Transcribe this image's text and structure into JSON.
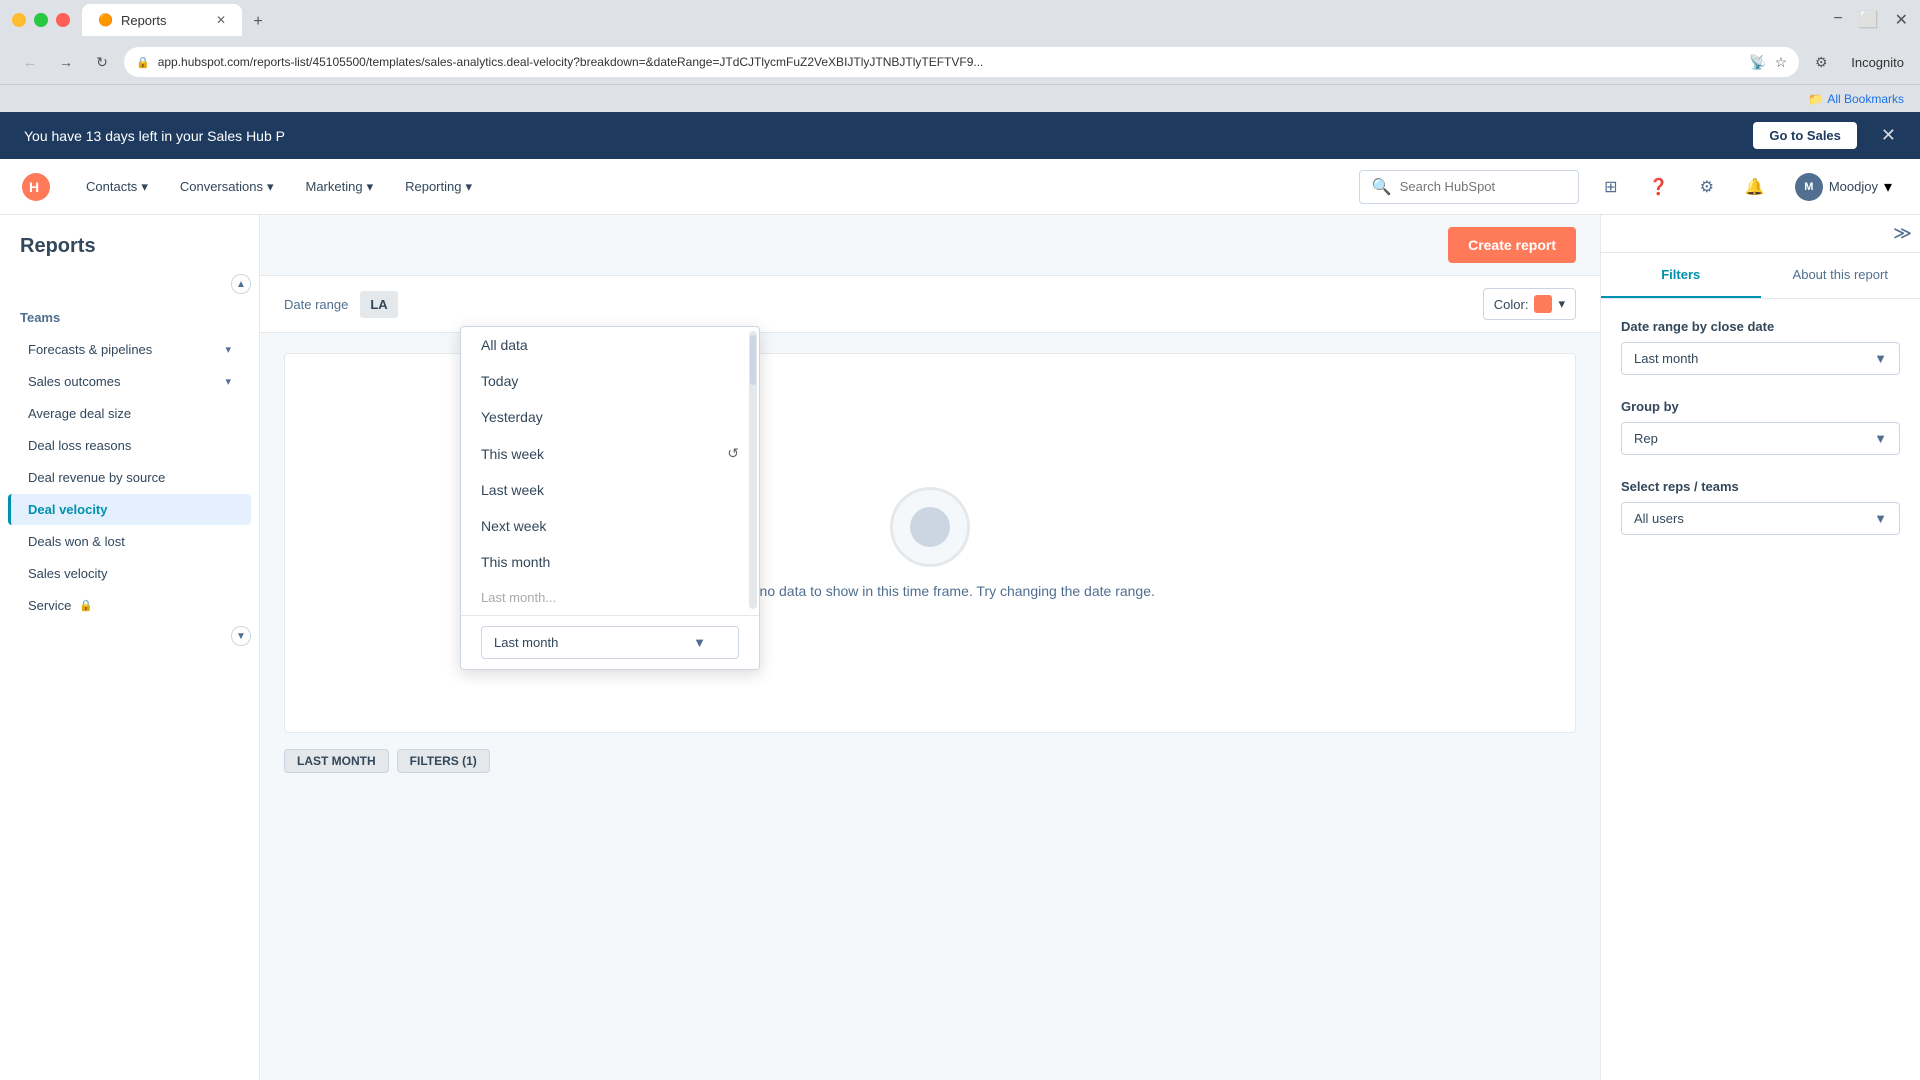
{
  "browser": {
    "tab_title": "Reports",
    "tab_icon": "🟠",
    "url": "app.hubspot.com/reports-list/45105500/templates/sales-analytics.deal-velocity?breakdown=&dateRange=JTdCJTlycmFuZ2VeXBIJTlyJTNBJTlyTEFTVF9...",
    "new_tab": "+",
    "incognito": "Incognito",
    "bookmarks_label": "All Bookmarks"
  },
  "promo_banner": {
    "text": "You have 13 days left in your Sales Hub P",
    "cta": "Go to Sales",
    "close": "✕"
  },
  "top_nav": {
    "logo": "🟠",
    "items": [
      {
        "label": "Contacts",
        "has_arrow": true
      },
      {
        "label": "Conversations",
        "has_arrow": true
      },
      {
        "label": "Marketing",
        "has_arrow": true
      },
      {
        "label": "Reporting",
        "has_arrow": true
      }
    ],
    "search_placeholder": "Search HubSpot",
    "user_name": "Moodjoy",
    "user_initials": "M"
  },
  "sidebar": {
    "title": "Reports",
    "create_btn": "Create report",
    "categories": [
      {
        "label": "Teams",
        "items": [
          {
            "label": "Forecasts & pipelines",
            "has_arrow": true,
            "active": false
          },
          {
            "label": "Sales outcomes",
            "has_arrow": true,
            "active": false
          },
          {
            "label": "Average deal size",
            "active": false
          },
          {
            "label": "Deal loss reasons",
            "active": false
          },
          {
            "label": "Deal revenue by source",
            "active": false
          },
          {
            "label": "Deal velocity",
            "active": true
          },
          {
            "label": "Deals won & lost",
            "active": false
          },
          {
            "label": "Sales velocity",
            "active": false
          },
          {
            "label": "Service",
            "has_lock": true,
            "active": false
          }
        ]
      }
    ]
  },
  "toolbar": {
    "date_range_label": "Date range",
    "date_value": "LA",
    "color_label": "Color:"
  },
  "dropdown": {
    "items": [
      {
        "label": "All data",
        "selected": false
      },
      {
        "label": "Today",
        "selected": false
      },
      {
        "label": "Yesterday",
        "selected": false
      },
      {
        "label": "This week",
        "selected": false
      },
      {
        "label": "Last week",
        "selected": false
      },
      {
        "label": "Next week",
        "selected": false
      },
      {
        "label": "This month",
        "selected": false
      },
      {
        "label": "Last month",
        "selected": true
      }
    ],
    "selected_label": "Last month"
  },
  "chart": {
    "no_data_text": "There is no data to show in this time frame. Try changing the date range.",
    "badges": [
      {
        "label": "LAST MONTH"
      },
      {
        "label": "FILTERS (1)"
      }
    ]
  },
  "right_panel": {
    "tabs": [
      {
        "label": "Filters",
        "active": true
      },
      {
        "label": "About this report",
        "active": false
      }
    ],
    "filters": [
      {
        "label": "Date range by close date",
        "value": "Last month"
      },
      {
        "label": "Group by",
        "value": "Rep"
      },
      {
        "label": "Select reps / teams",
        "value": "All users"
      }
    ]
  }
}
